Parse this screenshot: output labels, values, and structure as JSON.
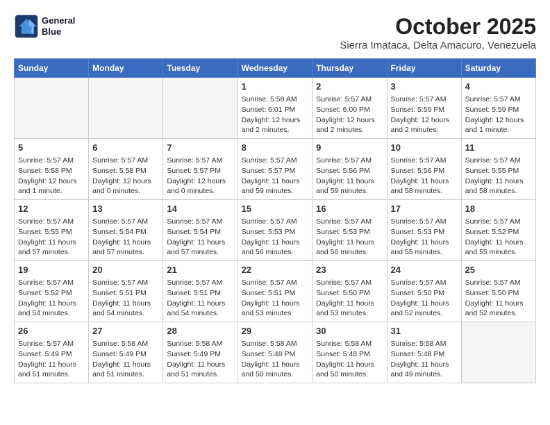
{
  "logo": {
    "line1": "General",
    "line2": "Blue"
  },
  "title": "October 2025",
  "subtitle": "Sierra Imataca, Delta Amacuro, Venezuela",
  "weekdays": [
    "Sunday",
    "Monday",
    "Tuesday",
    "Wednesday",
    "Thursday",
    "Friday",
    "Saturday"
  ],
  "weeks": [
    [
      {
        "day": "",
        "info": ""
      },
      {
        "day": "",
        "info": ""
      },
      {
        "day": "",
        "info": ""
      },
      {
        "day": "1",
        "info": "Sunrise: 5:58 AM\nSunset: 6:01 PM\nDaylight: 12 hours\nand 2 minutes."
      },
      {
        "day": "2",
        "info": "Sunrise: 5:57 AM\nSunset: 6:00 PM\nDaylight: 12 hours\nand 2 minutes."
      },
      {
        "day": "3",
        "info": "Sunrise: 5:57 AM\nSunset: 5:59 PM\nDaylight: 12 hours\nand 2 minutes."
      },
      {
        "day": "4",
        "info": "Sunrise: 5:57 AM\nSunset: 5:59 PM\nDaylight: 12 hours\nand 1 minute."
      }
    ],
    [
      {
        "day": "5",
        "info": "Sunrise: 5:57 AM\nSunset: 5:58 PM\nDaylight: 12 hours\nand 1 minute."
      },
      {
        "day": "6",
        "info": "Sunrise: 5:57 AM\nSunset: 5:58 PM\nDaylight: 12 hours\nand 0 minutes."
      },
      {
        "day": "7",
        "info": "Sunrise: 5:57 AM\nSunset: 5:57 PM\nDaylight: 12 hours\nand 0 minutes."
      },
      {
        "day": "8",
        "info": "Sunrise: 5:57 AM\nSunset: 5:57 PM\nDaylight: 11 hours\nand 59 minutes."
      },
      {
        "day": "9",
        "info": "Sunrise: 5:57 AM\nSunset: 5:56 PM\nDaylight: 11 hours\nand 59 minutes."
      },
      {
        "day": "10",
        "info": "Sunrise: 5:57 AM\nSunset: 5:56 PM\nDaylight: 11 hours\nand 58 minutes."
      },
      {
        "day": "11",
        "info": "Sunrise: 5:57 AM\nSunset: 5:55 PM\nDaylight: 11 hours\nand 58 minutes."
      }
    ],
    [
      {
        "day": "12",
        "info": "Sunrise: 5:57 AM\nSunset: 5:55 PM\nDaylight: 11 hours\nand 57 minutes."
      },
      {
        "day": "13",
        "info": "Sunrise: 5:57 AM\nSunset: 5:54 PM\nDaylight: 11 hours\nand 57 minutes."
      },
      {
        "day": "14",
        "info": "Sunrise: 5:57 AM\nSunset: 5:54 PM\nDaylight: 11 hours\nand 57 minutes."
      },
      {
        "day": "15",
        "info": "Sunrise: 5:57 AM\nSunset: 5:53 PM\nDaylight: 11 hours\nand 56 minutes."
      },
      {
        "day": "16",
        "info": "Sunrise: 5:57 AM\nSunset: 5:53 PM\nDaylight: 11 hours\nand 56 minutes."
      },
      {
        "day": "17",
        "info": "Sunrise: 5:57 AM\nSunset: 5:53 PM\nDaylight: 11 hours\nand 55 minutes."
      },
      {
        "day": "18",
        "info": "Sunrise: 5:57 AM\nSunset: 5:52 PM\nDaylight: 11 hours\nand 55 minutes."
      }
    ],
    [
      {
        "day": "19",
        "info": "Sunrise: 5:57 AM\nSunset: 5:52 PM\nDaylight: 11 hours\nand 54 minutes."
      },
      {
        "day": "20",
        "info": "Sunrise: 5:57 AM\nSunset: 5:51 PM\nDaylight: 11 hours\nand 54 minutes."
      },
      {
        "day": "21",
        "info": "Sunrise: 5:57 AM\nSunset: 5:51 PM\nDaylight: 11 hours\nand 54 minutes."
      },
      {
        "day": "22",
        "info": "Sunrise: 5:57 AM\nSunset: 5:51 PM\nDaylight: 11 hours\nand 53 minutes."
      },
      {
        "day": "23",
        "info": "Sunrise: 5:57 AM\nSunset: 5:50 PM\nDaylight: 11 hours\nand 53 minutes."
      },
      {
        "day": "24",
        "info": "Sunrise: 5:57 AM\nSunset: 5:50 PM\nDaylight: 11 hours\nand 52 minutes."
      },
      {
        "day": "25",
        "info": "Sunrise: 5:57 AM\nSunset: 5:50 PM\nDaylight: 11 hours\nand 52 minutes."
      }
    ],
    [
      {
        "day": "26",
        "info": "Sunrise: 5:57 AM\nSunset: 5:49 PM\nDaylight: 11 hours\nand 51 minutes."
      },
      {
        "day": "27",
        "info": "Sunrise: 5:58 AM\nSunset: 5:49 PM\nDaylight: 11 hours\nand 51 minutes."
      },
      {
        "day": "28",
        "info": "Sunrise: 5:58 AM\nSunset: 5:49 PM\nDaylight: 11 hours\nand 51 minutes."
      },
      {
        "day": "29",
        "info": "Sunrise: 5:58 AM\nSunset: 5:48 PM\nDaylight: 11 hours\nand 50 minutes."
      },
      {
        "day": "30",
        "info": "Sunrise: 5:58 AM\nSunset: 5:48 PM\nDaylight: 11 hours\nand 50 minutes."
      },
      {
        "day": "31",
        "info": "Sunrise: 5:58 AM\nSunset: 5:48 PM\nDaylight: 11 hours\nand 49 minutes."
      },
      {
        "day": "",
        "info": ""
      }
    ]
  ]
}
